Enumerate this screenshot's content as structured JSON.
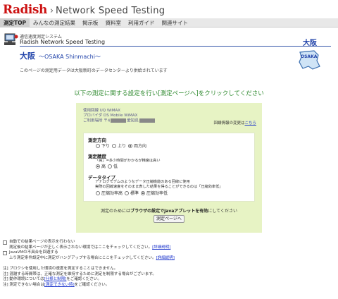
{
  "header": {
    "logo": "Radish",
    "separator": "›",
    "site_title": "Network Speed Testing"
  },
  "nav": {
    "items": [
      {
        "label": "測定TOP",
        "active": true
      },
      {
        "label": "みんなの測定結果"
      },
      {
        "label": "掲示板"
      },
      {
        "label": "資料室"
      },
      {
        "label": "利用ガイド"
      },
      {
        "label": "関連サイト"
      }
    ]
  },
  "system": {
    "subtitle": "通信速度測定システム",
    "title": "Radish Network Speed Testing",
    "region_label": "大阪"
  },
  "region": {
    "name": "大阪",
    "subtitle": "～OSAKA Shinmachi～",
    "badge_text": "OSAKA",
    "note": "このページの測定用データは大阪新町のデータセンターより供給されています"
  },
  "instruction": "以下の測定に関する設定を行い[測定ページへ]をクリックしてください",
  "panel": {
    "line1": "使用回線 UQ WiMAX",
    "line2": "プロバイダ DS Mobile WiMAX",
    "line3_prefix": "ご利用場所 〒4",
    "line3_middle": "愛知県",
    "change_text": "回線情報の変更は",
    "change_link": "こちら",
    "direction": {
      "title": "測定方向",
      "options": [
        "下り",
        "上り",
        "両方向"
      ],
      "selected": 2
    },
    "accuracy": {
      "title": "測定精度",
      "desc": "「高」=多少時間がかかるが精度は高い",
      "options": [
        "高",
        "低"
      ],
      "selected": 0
    },
    "datatype": {
      "title": "データタイプ",
      "desc1": "アナログモデムのようなデータ圧縮機能のある回線に使用",
      "desc2": "実際の回線速度をそのまま表した結果を得ることができるのは「圧縮効率低」",
      "options": [
        "圧縮効率高",
        "標準",
        "圧縮効率低"
      ],
      "selected": 2
    },
    "java_pre": "測定のためには",
    "java_bold": "ブラウザの設定でJavaアプレットを有効",
    "java_post": "にしてください",
    "run_button": "測定ページへ"
  },
  "footer": {
    "check1_label": "自動での結果ページの表示を行わない",
    "check1_desc": "測定後の結果ページが正しく表示されない環境ではここをチェックしてください。",
    "check1_link": "[詳細説明]",
    "check2_label": "JavaVMの不具合を回避する",
    "check2_desc": "上り測定条件設定中に測定がハングアップする場合にここをチェックしてください。",
    "check2_link": "[詳細説明]",
    "note1": "注] プロクシを使用した環境の速度を測定することはできません。",
    "note2": "注] 混雑する時間帯は、正確な測定を維持するために測定を制限する場合がございます。",
    "note3_pre": "注] 動作環境については",
    "note3_link": "[仕様と制限]",
    "note3_post": "をご確認ください。",
    "note4_pre": "注] 測定できない場合は",
    "note4_link": "[測定できない時]",
    "note4_post": "をご確認ください。"
  },
  "colors": {
    "logo": "#cc1111",
    "accent_blue": "#2244aa",
    "instruction_green": "#2f8a2f",
    "panel_bg": "#e7f3c4",
    "link": "#1a33cc"
  }
}
